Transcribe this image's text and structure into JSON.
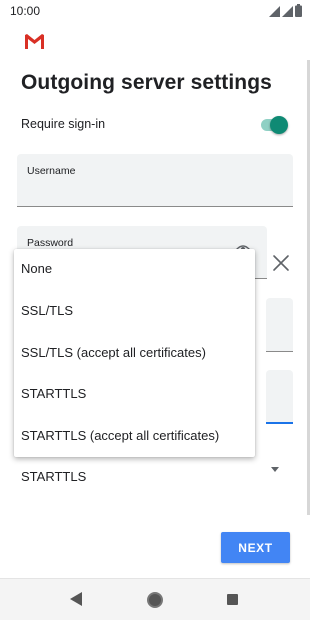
{
  "status_bar": {
    "time": "10:00"
  },
  "header": {
    "title": "Outgoing server settings"
  },
  "sign_in": {
    "label": "Require sign-in",
    "enabled": true
  },
  "username": {
    "label": "Username",
    "value": ""
  },
  "password": {
    "label": "Password",
    "value": ""
  },
  "security": {
    "selected": "STARTTLS",
    "options": [
      "None",
      "SSL/TLS",
      "SSL/TLS (accept all certificates)",
      "STARTTLS",
      "STARTTLS (accept all certificates)"
    ]
  },
  "next_button": {
    "label": "NEXT"
  },
  "colors": {
    "accent": "#0f8a74",
    "primary_button": "#4285f4",
    "gmail_red": "#d93025"
  },
  "icons": [
    "gmail-logo-icon",
    "signal-icon",
    "battery-icon",
    "eye-icon",
    "close-icon",
    "back-icon",
    "home-icon",
    "recents-icon"
  ]
}
